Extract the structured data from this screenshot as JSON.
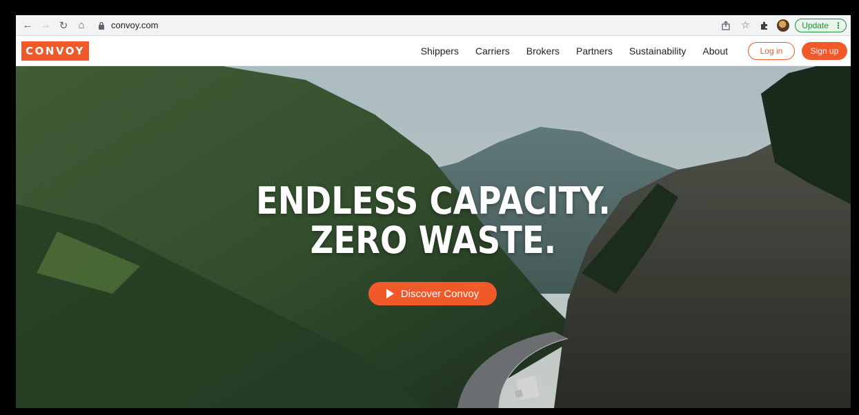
{
  "browser": {
    "url": "convoy.com",
    "update_label": "Update",
    "icons": [
      "back-icon",
      "forward-icon",
      "reload-icon",
      "home-icon",
      "lock-icon",
      "share-icon",
      "star-icon",
      "extensions-icon",
      "avatar",
      "menu-icon"
    ]
  },
  "site": {
    "logo": "CONVOY",
    "nav": [
      "Shippers",
      "Carriers",
      "Brokers",
      "Partners",
      "Sustainability",
      "About"
    ],
    "login_label": "Log in",
    "signup_label": "Sign up",
    "brand_color": "#f05a2b"
  },
  "hero": {
    "line1": "ENDLESS CAPACITY.",
    "line2": "ZERO WASTE.",
    "cta_label": "Discover Convoy"
  }
}
